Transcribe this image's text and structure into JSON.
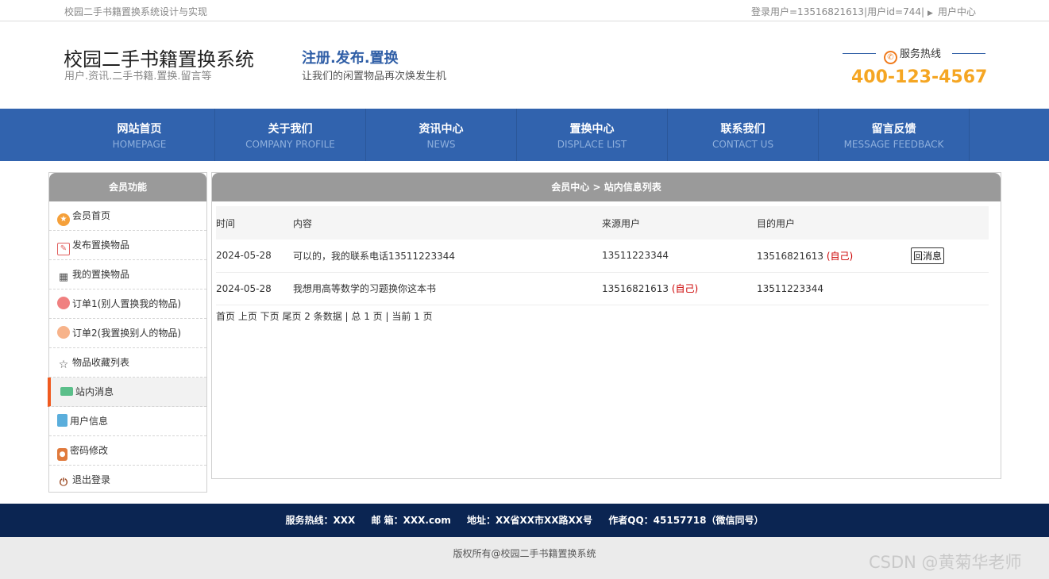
{
  "topbar": {
    "site_caption": "校园二手书籍置换系统设计与实现",
    "login_info": "登录用户=13516821613|用户id=744|",
    "user_center": "用户中心"
  },
  "header": {
    "site_name": "校园二手书籍置换系统",
    "site_sub": "用户.资讯.二手书籍.置换.留言等",
    "slogan": "注册.发布.置换",
    "slogan_sub": "让我们的闲置物品再次焕发生机",
    "hotline_label": "服务热线",
    "hotline_number": "400-123-4567"
  },
  "nav": [
    {
      "zh": "网站首页",
      "en": "HOMEPAGE"
    },
    {
      "zh": "关于我们",
      "en": "COMPANY PROFILE"
    },
    {
      "zh": "资讯中心",
      "en": "NEWS"
    },
    {
      "zh": "置换中心",
      "en": "DISPLACE LIST"
    },
    {
      "zh": "联系我们",
      "en": "CONTACT US"
    },
    {
      "zh": "留言反馈",
      "en": "MESSAGE FEEDBACK"
    }
  ],
  "sidebar": {
    "title": "会员功能",
    "items": [
      {
        "label": "会员首页"
      },
      {
        "label": "发布置换物品"
      },
      {
        "label": "我的置换物品"
      },
      {
        "label": "订单1(别人置换我的物品)"
      },
      {
        "label": "订单2(我置换别人的物品)"
      },
      {
        "label": "物品收藏列表"
      },
      {
        "label": "站内消息"
      },
      {
        "label": "用户信息"
      },
      {
        "label": "密码修改"
      },
      {
        "label": "退出登录"
      }
    ]
  },
  "content": {
    "title": "会员中心 > 站内信息列表",
    "columns": [
      "时间",
      "内容",
      "来源用户",
      "目的用户"
    ],
    "rows": [
      {
        "time": "2024-05-28",
        "content": "可以的，我的联系电话13511223344",
        "from": "13511223344",
        "from_tag": "",
        "to": "13516821613",
        "to_tag": "(自己)",
        "action": "回消息"
      },
      {
        "time": "2024-05-28",
        "content": "我想用高等数学的习题换你这本书",
        "from": "13516821613",
        "from_tag": "(自己)",
        "to": "13511223344",
        "to_tag": "",
        "action": ""
      }
    ],
    "pager": "首页 上页 下页 尾页 2 条数据 | 总 1 页 | 当前 1 页"
  },
  "footer": {
    "hotline": "服务热线：XXX",
    "email": "邮 箱：XXX.com",
    "address": "地址：XX省XX市XX路XX号",
    "qq": "作者QQ：45157718（微信同号）",
    "copyright": "版权所有@校园二手书籍置换系统"
  },
  "watermark": "CSDN @黄菊华老师"
}
